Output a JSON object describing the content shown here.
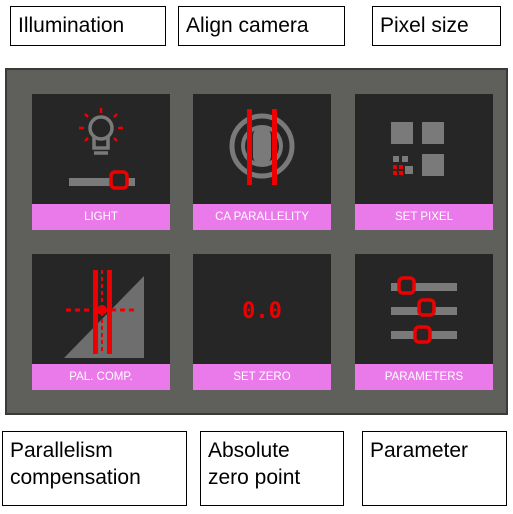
{
  "callouts_top": [
    "Illumination",
    "Align camera",
    "Pixel size"
  ],
  "callouts_bottom": [
    {
      "line1": "Parallelism",
      "line2": "compensation"
    },
    {
      "line1": "Absolute",
      "line2": "zero point"
    },
    {
      "line1": "Parameter",
      "line2": ""
    }
  ],
  "tiles": [
    {
      "label": "LIGHT",
      "icon": "light-bulb-icon"
    },
    {
      "label": "CA PARALLELITY",
      "icon": "camera-parallelity-icon"
    },
    {
      "label": "SET PIXEL",
      "icon": "pixel-grid-icon"
    },
    {
      "label": "PAL. COMP.",
      "icon": "parallelism-compensation-icon"
    },
    {
      "label": "SET ZERO",
      "icon": "set-zero-icon",
      "display": "0.0"
    },
    {
      "label": "PARAMETERS",
      "icon": "parameter-sliders-icon"
    }
  ],
  "colors": {
    "panel": "#5f5f5b",
    "tile": "#262626",
    "label_bg": "#ea79ea",
    "accent_red": "#ee0000",
    "icon_gray": "#7a7a7a"
  }
}
